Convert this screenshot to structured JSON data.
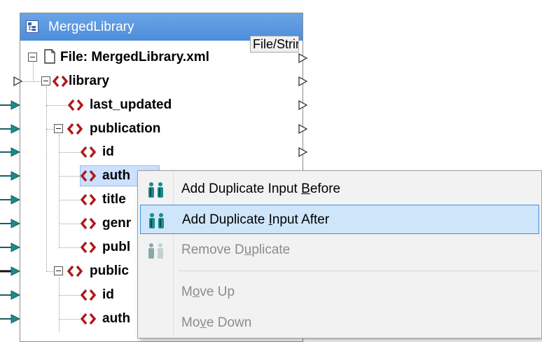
{
  "component": {
    "title": "MergedLibrary",
    "file_label": "File: MergedLibrary.xml",
    "file_button": "File/String"
  },
  "tree": [
    {
      "label": "library"
    },
    {
      "label": "last_updated"
    },
    {
      "label": "publication"
    },
    {
      "label": "id"
    },
    {
      "label": "auth"
    },
    {
      "label": "title"
    },
    {
      "label": "genr"
    },
    {
      "label": "publ"
    },
    {
      "label": "public"
    },
    {
      "label": "id"
    },
    {
      "label": "auth"
    }
  ],
  "context_menu": {
    "items": [
      {
        "pre": "Add Duplicate Input ",
        "key": "B",
        "post": "efore",
        "state": "normal",
        "icon": "duplicate-input-icon"
      },
      {
        "pre": "Add Duplicate ",
        "key": "I",
        "post": "nput After",
        "state": "hover",
        "icon": "duplicate-input-icon"
      },
      {
        "pre": "Remove D",
        "key": "u",
        "post": "plicate",
        "state": "disabled",
        "icon": "remove-duplicate-icon"
      },
      {
        "pre": "M",
        "key": "o",
        "post": "ve Up",
        "state": "disabled"
      },
      {
        "pre": "Mo",
        "key": "v",
        "post": "e Down",
        "state": "disabled"
      }
    ]
  },
  "colors": {
    "title_bar": "#4d8ddb",
    "tag_icon": "#b01818",
    "connector_teal": "#1a8c8c",
    "menu_hover": "#cfe6fa",
    "menu_hover_border": "#3f8fd8"
  }
}
